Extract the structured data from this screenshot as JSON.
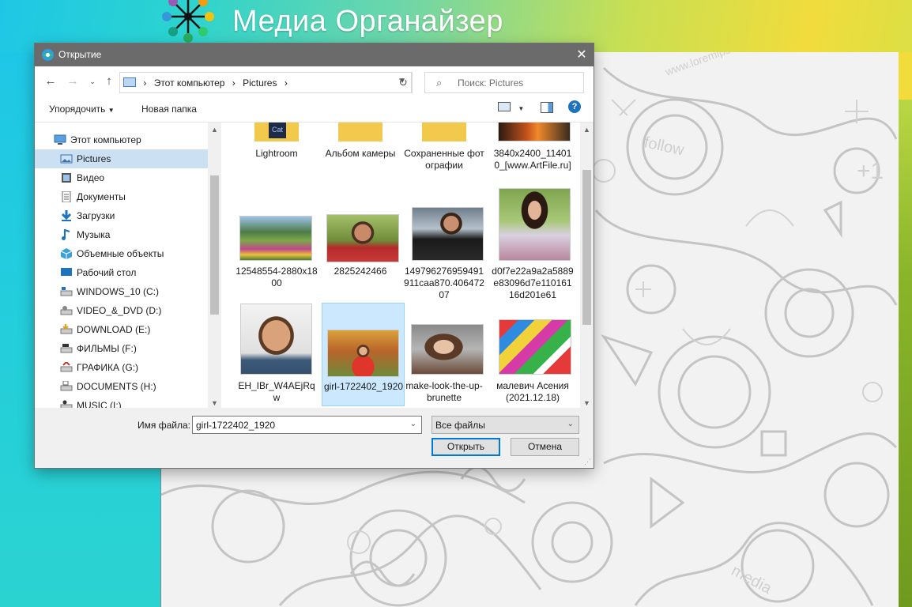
{
  "app": {
    "title": "Медиа Органайзер"
  },
  "dialog": {
    "title": "Открытие",
    "address": [
      "Этот компьютер",
      "Pictures"
    ],
    "search_placeholder": "Поиск: Pictures",
    "commands": {
      "organize": "Упорядочить",
      "new_folder": "Новая папка"
    },
    "tree": [
      {
        "label": "Этот компьютер",
        "icon": "computer-icon",
        "selected": false
      },
      {
        "label": "Pictures",
        "icon": "pictures-icon",
        "selected": true
      },
      {
        "label": "Видео",
        "icon": "video-icon",
        "selected": false
      },
      {
        "label": "Документы",
        "icon": "documents-icon",
        "selected": false
      },
      {
        "label": "Загрузки",
        "icon": "download-icon",
        "selected": false
      },
      {
        "label": "Музыка",
        "icon": "music-icon",
        "selected": false
      },
      {
        "label": "Объемные объекты",
        "icon": "3d-objects-icon",
        "selected": false
      },
      {
        "label": "Рабочий стол",
        "icon": "desktop-icon",
        "selected": false
      },
      {
        "label": "WINDOWS_10 (C:)",
        "icon": "drive-icon",
        "selected": false
      },
      {
        "label": "VIDEO_&_DVD (D:)",
        "icon": "drive-icon",
        "selected": false
      },
      {
        "label": "DOWNLOAD (E:)",
        "icon": "drive-icon",
        "selected": false
      },
      {
        "label": "ФИЛЬМЫ (F:)",
        "icon": "drive-icon",
        "selected": false
      },
      {
        "label": "ГРАФИКА (G:)",
        "icon": "drive-icon",
        "selected": false
      },
      {
        "label": "DOCUMENTS (H:)",
        "icon": "drive-icon",
        "selected": false
      },
      {
        "label": "MUSIC (I:)",
        "icon": "drive-icon",
        "selected": false
      }
    ],
    "files": [
      {
        "name": "Lightroom",
        "kind": "folder"
      },
      {
        "name": "Альбом камеры",
        "kind": "folder"
      },
      {
        "name": "Сохраненные фотографии",
        "kind": "folder"
      },
      {
        "name": "3840x2400_114010_[www.ArtFile.ru]",
        "kind": "image"
      },
      {
        "name": "12548554-2880x1800",
        "kind": "image"
      },
      {
        "name": "2825242466",
        "kind": "image"
      },
      {
        "name": "149796276959491911caa870.40647207",
        "kind": "image"
      },
      {
        "name": "d0f7e22a9a2a5889e83096d7e11016116d201e61",
        "kind": "image"
      },
      {
        "name": "EH_IBr_W4AEjRqw",
        "kind": "image"
      },
      {
        "name": "girl-1722402_1920",
        "kind": "image",
        "selected": true
      },
      {
        "name": "make-look-the-up-brunette",
        "kind": "image"
      },
      {
        "name": "малевич Асения (2021.12.18)",
        "kind": "image"
      }
    ],
    "filename_label": "Имя файла:",
    "filename_value": "girl-1722402_1920",
    "filetype_value": "Все файлы",
    "open_button": "Открыть",
    "cancel_button": "Отмена"
  }
}
